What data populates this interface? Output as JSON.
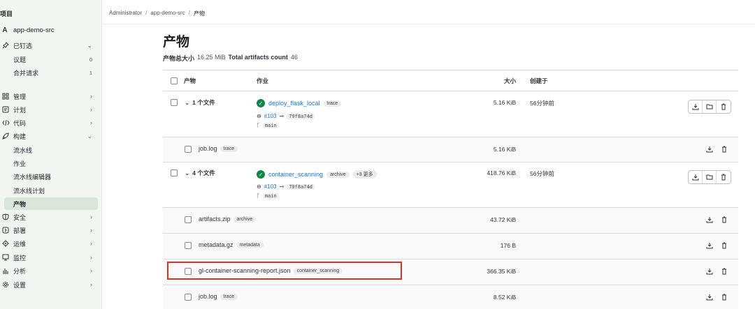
{
  "sidebar": {
    "header": "项目",
    "project": {
      "avatar": "A",
      "name": "app-demo-src"
    },
    "pinned": {
      "label": "已钉选",
      "items": [
        {
          "label": "议题",
          "count": "0"
        },
        {
          "label": "合并请求",
          "count": "1"
        }
      ]
    },
    "sections": [
      {
        "label": "管理",
        "icon": "manage-icon"
      },
      {
        "label": "计划",
        "icon": "plan-icon"
      },
      {
        "label": "代码",
        "icon": "code-icon"
      },
      {
        "label": "构建",
        "icon": "rocket-icon"
      }
    ],
    "build_items": [
      "流水线",
      "作业",
      "流水线编辑器",
      "流水线计划",
      "产物"
    ],
    "lower_sections": [
      {
        "label": "安全",
        "icon": "shield-icon"
      },
      {
        "label": "部署",
        "icon": "deploy-icon"
      },
      {
        "label": "运维",
        "icon": "operate-icon"
      },
      {
        "label": "监控",
        "icon": "monitor-icon"
      },
      {
        "label": "分析",
        "icon": "chart-icon"
      },
      {
        "label": "设置",
        "icon": "settings-icon"
      }
    ]
  },
  "breadcrumb": [
    "Administrator",
    "app-demo-src",
    "产物"
  ],
  "page": {
    "title": "产物",
    "size_label": "产物总大小",
    "size_value": "16.25 MiB",
    "count_label": "Total artifacts count",
    "count_value": "46"
  },
  "table": {
    "headers": {
      "artifacts": "产物",
      "job": "作业",
      "size": "大小",
      "created": "创建于"
    },
    "groups": [
      {
        "label": "1 个文件",
        "job": "deploy_flask_local",
        "job_badge": "trace",
        "extra_badge": "",
        "pipeline": "#103",
        "commit": "79f8a74d",
        "branch": "main",
        "size": "5.16 KiB",
        "created": "56分钟前",
        "files": [
          {
            "name": "job.log",
            "type": "trace",
            "size": "5.16 KiB"
          }
        ]
      },
      {
        "label": "4 个文件",
        "job": "container_scanning",
        "job_badge": "archive",
        "extra_badge": "+3 更多",
        "pipeline": "#103",
        "commit": "79f8a74d",
        "branch": "main",
        "size": "418.76 KiB",
        "created": "56分钟前",
        "files": [
          {
            "name": "artifacts.zip",
            "type": "archive",
            "size": "43.72 KiB"
          },
          {
            "name": "metadata.gz",
            "type": "metadata",
            "size": "176 B"
          },
          {
            "name": "gl-container-scanning-report.json",
            "type": "container_scanning",
            "size": "366.35 KiB"
          },
          {
            "name": "job.log",
            "type": "trace",
            "size": "8.52 KiB"
          }
        ]
      }
    ]
  },
  "colors": {
    "highlight": "#d9302a",
    "link": "#1f75cb",
    "success": "#108548",
    "sidebar_bg": "#f1f6f1"
  }
}
